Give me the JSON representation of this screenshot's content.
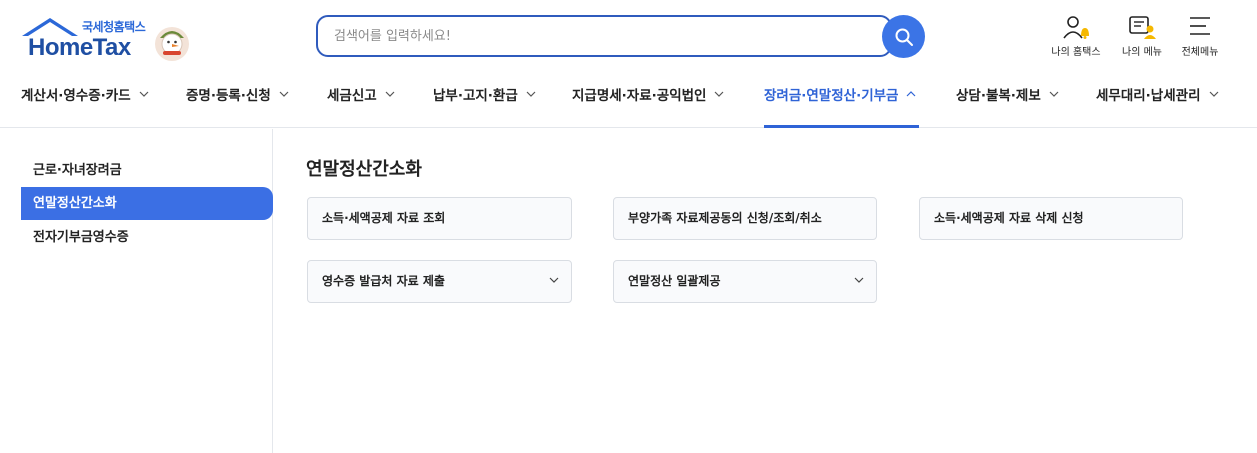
{
  "logo": {
    "subtitle": "국세청홈택스",
    "title": "HomeTax"
  },
  "search": {
    "placeholder": "검색어를 입력하세요!"
  },
  "utility": {
    "my_hometax": "나의 홈택스",
    "my_menu": "나의 메뉴",
    "all_menu": "전체메뉴"
  },
  "nav": {
    "items": [
      {
        "label": "계산서·영수증·카드"
      },
      {
        "label": "증명·등록·신청"
      },
      {
        "label": "세금신고"
      },
      {
        "label": "납부·고지·환급"
      },
      {
        "label": "지급명세·자료·공익법인"
      },
      {
        "label": "장려금·연말정산·기부금"
      },
      {
        "label": "상담·불복·제보"
      },
      {
        "label": "세무대리·납세관리"
      }
    ],
    "active_index": 5
  },
  "sidebar": {
    "items": [
      {
        "label": "근로·자녀장려금"
      },
      {
        "label": "연말정산간소화"
      },
      {
        "label": "전자기부금영수증"
      }
    ],
    "active_index": 1
  },
  "main": {
    "title": "연말정산간소화",
    "cards": [
      {
        "label": "소득·세액공제 자료 조회"
      },
      {
        "label": "부양가족 자료제공동의 신청/조회/취소"
      },
      {
        "label": "소득·세액공제 자료 삭제 신청"
      },
      {
        "label": "영수증 발급처 자료 제출"
      },
      {
        "label": "연말정산 일괄제공"
      }
    ]
  },
  "colors": {
    "accent": "#2f63d6",
    "active_bg": "#3b6fe4",
    "search_border": "#2f5bbd"
  }
}
